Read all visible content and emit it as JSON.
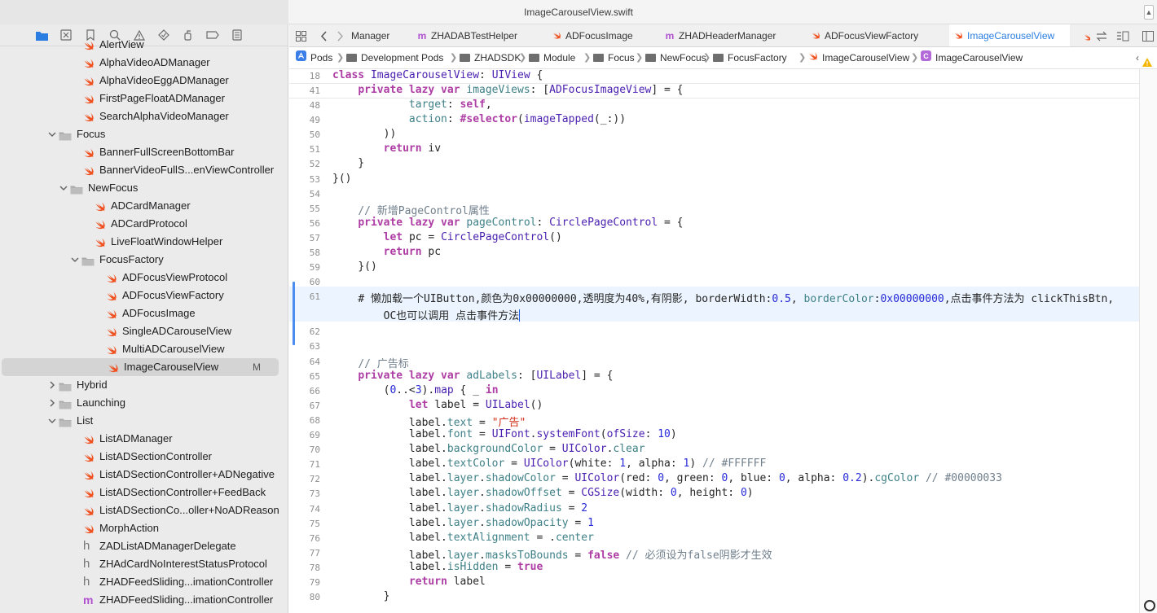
{
  "window": {
    "title": "ImageCarouselView.swift"
  },
  "sidebar": {
    "rows": [
      {
        "label": "AlertView",
        "kind": "swift",
        "depth": 2
      },
      {
        "label": "AlphaVideoADManager",
        "kind": "swift",
        "depth": 2
      },
      {
        "label": "AlphaVideoEggADManager",
        "kind": "swift",
        "depth": 2
      },
      {
        "label": "FirstPageFloatADManager",
        "kind": "swift",
        "depth": 2
      },
      {
        "label": "SearchAlphaVideoManager",
        "kind": "swift",
        "depth": 2
      },
      {
        "label": "Focus",
        "kind": "folder-open",
        "depth": 1
      },
      {
        "label": "BannerFullScreenBottomBar",
        "kind": "swift",
        "depth": 2
      },
      {
        "label": "BannerVideoFullS...enViewController",
        "kind": "swift",
        "depth": 2
      },
      {
        "label": "NewFocus",
        "kind": "folder-open",
        "depth": 2
      },
      {
        "label": "ADCardManager",
        "kind": "swift",
        "depth": 3
      },
      {
        "label": "ADCardProtocol",
        "kind": "swift",
        "depth": 3
      },
      {
        "label": "LiveFloatWindowHelper",
        "kind": "swift",
        "depth": 3
      },
      {
        "label": "FocusFactory",
        "kind": "folder-open",
        "depth": 3
      },
      {
        "label": "ADFocusViewProtocol",
        "kind": "swift",
        "depth": 4
      },
      {
        "label": "ADFocusViewFactory",
        "kind": "swift",
        "depth": 4
      },
      {
        "label": "ADFocusImage",
        "kind": "swift",
        "depth": 4
      },
      {
        "label": "SingleADCarouselView",
        "kind": "swift",
        "depth": 4
      },
      {
        "label": "MultiADCarouselView",
        "kind": "swift",
        "depth": 4
      },
      {
        "label": "ImageCarouselView",
        "kind": "swift",
        "depth": 4,
        "selected": true,
        "badge": "M"
      },
      {
        "label": "Hybrid",
        "kind": "folder-closed",
        "depth": 1
      },
      {
        "label": "Launching",
        "kind": "folder-closed",
        "depth": 1
      },
      {
        "label": "List",
        "kind": "folder-open",
        "depth": 1
      },
      {
        "label": "ListADManager",
        "kind": "swift",
        "depth": 2
      },
      {
        "label": "ListADSectionController",
        "kind": "swift",
        "depth": 2
      },
      {
        "label": "ListADSectionController+ADNegative",
        "kind": "swift",
        "depth": 2
      },
      {
        "label": "ListADSectionController+FeedBack",
        "kind": "swift",
        "depth": 2
      },
      {
        "label": "ListADSectionCo...oller+NoADReason",
        "kind": "swift",
        "depth": 2
      },
      {
        "label": "MorphAction",
        "kind": "swift",
        "depth": 2
      },
      {
        "label": "ZADListADManagerDelegate",
        "kind": "h",
        "depth": 2
      },
      {
        "label": "ZHAdCardNoInterestStatusProtocol",
        "kind": "h",
        "depth": 2
      },
      {
        "label": "ZHADFeedSliding...imationController",
        "kind": "h",
        "depth": 2
      },
      {
        "label": "ZHADFeedSliding...imationController",
        "kind": "m",
        "depth": 2
      }
    ]
  },
  "tabs": [
    {
      "label": "Manager",
      "kind": "swift",
      "active": false
    },
    {
      "label": "ZHADABTestHelper",
      "kind": "m",
      "active": false
    },
    {
      "label": "ADFocusImage",
      "kind": "swift",
      "active": false
    },
    {
      "label": "ZHADHeaderManager",
      "kind": "m",
      "active": false
    },
    {
      "label": "ADFocusViewFactory",
      "kind": "swift",
      "active": false
    },
    {
      "label": "ImageCarouselView",
      "kind": "swift",
      "active": true
    }
  ],
  "breadcrumb": [
    "Pods",
    "Development Pods",
    "ZHADSDK",
    "Module",
    "Focus",
    "NewFocus",
    "FocusFactory",
    "ImageCarouselView",
    "ImageCarouselView"
  ],
  "code": [
    {
      "n": "18",
      "sticky": true,
      "t": [
        [
          "kw",
          "class "
        ],
        [
          "ty",
          "ImageCarouselView"
        ],
        [
          "",
          ": "
        ],
        [
          "ty",
          "UIView"
        ],
        [
          "",
          " {"
        ]
      ]
    },
    {
      "n": "41",
      "sticky": true,
      "t": [
        [
          "",
          "    "
        ],
        [
          "kw",
          "private lazy var "
        ],
        [
          "pr",
          "imageViews"
        ],
        [
          "",
          ": ["
        ],
        [
          "ty",
          "ADFocusImageView"
        ],
        [
          "",
          "] = {"
        ]
      ]
    },
    {
      "n": "48",
      "t": [
        [
          "",
          "            "
        ],
        [
          "pr",
          "target"
        ],
        [
          "",
          ": "
        ],
        [
          "kw",
          "self"
        ],
        [
          "",
          ","
        ]
      ]
    },
    {
      "n": "49",
      "t": [
        [
          "",
          "            "
        ],
        [
          "pr",
          "action"
        ],
        [
          "",
          ": "
        ],
        [
          "kw",
          "#selector"
        ],
        [
          "",
          "("
        ],
        [
          "ty",
          "imageTapped"
        ],
        [
          "",
          "(_:))"
        ]
      ]
    },
    {
      "n": "50",
      "t": [
        [
          "",
          "        ))"
        ]
      ]
    },
    {
      "n": "51",
      "t": [
        [
          "",
          "        "
        ],
        [
          "kw",
          "return "
        ],
        [
          "",
          "iv"
        ]
      ]
    },
    {
      "n": "52",
      "t": [
        [
          "",
          "    }"
        ]
      ]
    },
    {
      "n": "53",
      "t": [
        [
          "",
          "}()"
        ]
      ]
    },
    {
      "n": "54",
      "t": []
    },
    {
      "n": "55",
      "t": [
        [
          "cm",
          "// 新增PageControl属性"
        ]
      ]
    },
    {
      "n": "56",
      "t": [
        [
          "kw",
          "private lazy var "
        ],
        [
          "pr",
          "pageControl"
        ],
        [
          "",
          ": "
        ],
        [
          "ty",
          "CirclePageControl"
        ],
        [
          "",
          " = {"
        ]
      ]
    },
    {
      "n": "57",
      "t": [
        [
          "",
          "    "
        ],
        [
          "kw",
          "let "
        ],
        [
          "",
          "pc = "
        ],
        [
          "ty",
          "CirclePageControl"
        ],
        [
          "",
          "()"
        ]
      ]
    },
    {
      "n": "58",
      "t": [
        [
          "",
          "    "
        ],
        [
          "kw",
          "return "
        ],
        [
          "",
          "pc"
        ]
      ]
    },
    {
      "n": "59",
      "t": [
        [
          "",
          "}()"
        ]
      ]
    },
    {
      "n": "60",
      "t": []
    },
    {
      "n": "61",
      "current": true,
      "t": [
        [
          "",
          "# 懒加载一个UIButton,颜色为0x00000000,透明度为40%,有阴影, borderWidth:"
        ],
        [
          "nu",
          "0.5"
        ],
        [
          "",
          ", "
        ],
        [
          "pr",
          "borderColor"
        ],
        [
          "",
          ":"
        ],
        [
          "nu",
          "0x00000000"
        ],
        [
          "",
          ",点击事件方法为 clickThisBtn,"
        ]
      ],
      "cont": [
        [
          "",
          "    OC也可以调用 点击事件方法"
        ]
      ]
    },
    {
      "n": "62",
      "t": []
    },
    {
      "n": "63",
      "t": []
    },
    {
      "n": "64",
      "t": [
        [
          "cm",
          "// 广告标"
        ]
      ]
    },
    {
      "n": "65",
      "t": [
        [
          "kw",
          "private lazy var "
        ],
        [
          "pr",
          "adLabels"
        ],
        [
          "",
          ": ["
        ],
        [
          "ty",
          "UILabel"
        ],
        [
          "",
          "] = {"
        ]
      ]
    },
    {
      "n": "66",
      "t": [
        [
          "",
          "    ("
        ],
        [
          "nu",
          "0"
        ],
        [
          "",
          "..<"
        ],
        [
          "nu",
          "3"
        ],
        [
          "",
          ")."
        ],
        [
          "ty",
          "map"
        ],
        [
          "",
          " { _ "
        ],
        [
          "kw",
          "in"
        ]
      ]
    },
    {
      "n": "67",
      "t": [
        [
          "",
          "        "
        ],
        [
          "kw",
          "let "
        ],
        [
          "",
          "label = "
        ],
        [
          "ty",
          "UILabel"
        ],
        [
          "",
          "()"
        ]
      ]
    },
    {
      "n": "68",
      "t": [
        [
          "",
          "        label."
        ],
        [
          "pr",
          "text"
        ],
        [
          "",
          " = "
        ],
        [
          "st",
          "\"广告\""
        ]
      ]
    },
    {
      "n": "69",
      "t": [
        [
          "",
          "        label."
        ],
        [
          "pr",
          "font"
        ],
        [
          "",
          " = "
        ],
        [
          "ty",
          "UIFont"
        ],
        [
          "",
          "."
        ],
        [
          "ty",
          "systemFont"
        ],
        [
          "",
          "("
        ],
        [
          "ty",
          "ofSize"
        ],
        [
          "",
          ": "
        ],
        [
          "nu",
          "10"
        ],
        [
          "",
          ")"
        ]
      ]
    },
    {
      "n": "70",
      "t": [
        [
          "",
          "        label."
        ],
        [
          "pr",
          "backgroundColor"
        ],
        [
          "",
          " = "
        ],
        [
          "ty",
          "UIColor"
        ],
        [
          "",
          "."
        ],
        [
          "pr",
          "clear"
        ]
      ]
    },
    {
      "n": "71",
      "t": [
        [
          "",
          "        label."
        ],
        [
          "pr",
          "textColor"
        ],
        [
          "",
          " = "
        ],
        [
          "ty",
          "UIColor"
        ],
        [
          "",
          "(white: "
        ],
        [
          "nu",
          "1"
        ],
        [
          "",
          ", alpha: "
        ],
        [
          "nu",
          "1"
        ],
        [
          "",
          ") "
        ],
        [
          "cm",
          "// #FFFFFF"
        ]
      ]
    },
    {
      "n": "72",
      "t": [
        [
          "",
          "        label."
        ],
        [
          "pr",
          "layer"
        ],
        [
          "",
          "."
        ],
        [
          "pr",
          "shadowColor"
        ],
        [
          "",
          " = "
        ],
        [
          "ty",
          "UIColor"
        ],
        [
          "",
          "(red: "
        ],
        [
          "nu",
          "0"
        ],
        [
          "",
          ", green: "
        ],
        [
          "nu",
          "0"
        ],
        [
          "",
          ", blue: "
        ],
        [
          "nu",
          "0"
        ],
        [
          "",
          ", alpha: "
        ],
        [
          "nu",
          "0.2"
        ],
        [
          "",
          ")."
        ],
        [
          "pr",
          "cgColor"
        ],
        [
          "cm",
          " // #00000033"
        ]
      ]
    },
    {
      "n": "73",
      "t": [
        [
          "",
          "        label."
        ],
        [
          "pr",
          "layer"
        ],
        [
          "",
          "."
        ],
        [
          "pr",
          "shadowOffset"
        ],
        [
          "",
          " = "
        ],
        [
          "ty",
          "CGSize"
        ],
        [
          "",
          "(width: "
        ],
        [
          "nu",
          "0"
        ],
        [
          "",
          ", height: "
        ],
        [
          "nu",
          "0"
        ],
        [
          "",
          ")"
        ]
      ]
    },
    {
      "n": "74",
      "t": [
        [
          "",
          "        label."
        ],
        [
          "pr",
          "layer"
        ],
        [
          "",
          "."
        ],
        [
          "pr",
          "shadowRadius"
        ],
        [
          "",
          " = "
        ],
        [
          "nu",
          "2"
        ]
      ]
    },
    {
      "n": "75",
      "t": [
        [
          "",
          "        label."
        ],
        [
          "pr",
          "layer"
        ],
        [
          "",
          "."
        ],
        [
          "pr",
          "shadowOpacity"
        ],
        [
          "",
          " = "
        ],
        [
          "nu",
          "1"
        ]
      ]
    },
    {
      "n": "76",
      "t": [
        [
          "",
          "        label."
        ],
        [
          "pr",
          "textAlignment"
        ],
        [
          "",
          " = ."
        ],
        [
          "pr",
          "center"
        ]
      ]
    },
    {
      "n": "77",
      "t": [
        [
          "",
          "        label."
        ],
        [
          "pr",
          "layer"
        ],
        [
          "",
          "."
        ],
        [
          "pr",
          "masksToBounds"
        ],
        [
          "",
          " = "
        ],
        [
          "kw",
          "false"
        ],
        [
          "cm",
          " // 必须设为false阴影才生效"
        ]
      ]
    },
    {
      "n": "78",
      "t": [
        [
          "",
          "        label."
        ],
        [
          "pr",
          "isHidden"
        ],
        [
          "",
          " = "
        ],
        [
          "kw",
          "true"
        ]
      ]
    },
    {
      "n": "79",
      "t": [
        [
          "",
          "        "
        ],
        [
          "kw",
          "return "
        ],
        [
          "",
          "label"
        ]
      ]
    },
    {
      "n": "80",
      "t": [
        [
          "",
          "    }"
        ]
      ]
    }
  ]
}
